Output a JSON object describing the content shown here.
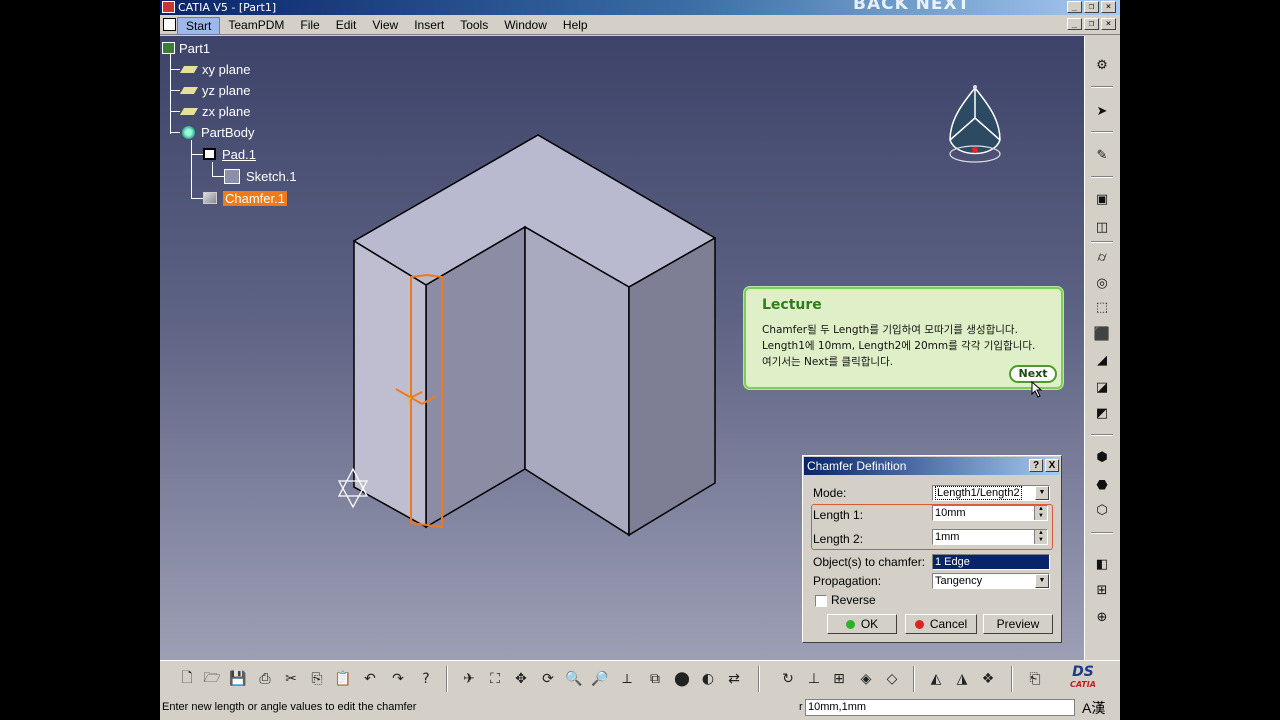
{
  "window": {
    "title": "CATIA V5 - [Part1]",
    "overlay_brand": "BACK  NEXT",
    "controls": [
      "_",
      "❐",
      "×"
    ]
  },
  "menu": {
    "items": [
      "Start",
      "TeamPDM",
      "File",
      "Edit",
      "View",
      "Insert",
      "Tools",
      "Window",
      "Help"
    ]
  },
  "tree": {
    "root": "Part1",
    "planes": [
      "xy plane",
      "yz plane",
      "zx plane"
    ],
    "body": "PartBody",
    "pad": "Pad.1",
    "sketch": "Sketch.1",
    "chamfer": "Chamfer.1"
  },
  "lecture": {
    "title": "Lecture",
    "body": "Chamfer될 두 Length를 기입하여 모따기를 생성합니다.\nLength1에 10mm, Length2에 20mm를 각각 기입합니다.\n여기서는 Next를 클릭합니다.",
    "next_label": "Next"
  },
  "dialog": {
    "title": "Chamfer Definition",
    "help_btn": "?",
    "close_btn": "X",
    "mode_label": "Mode:",
    "mode_value": "Length1/Length2",
    "length1_label": "Length 1:",
    "length1_value": "10mm",
    "length2_label": "Length 2:",
    "length2_value": "1mm",
    "objects_label": "Object(s) to chamfer:",
    "objects_value": "1 Edge",
    "propagation_label": "Propagation:",
    "propagation_value": "Tangency",
    "reverse_label": "Reverse",
    "reverse_checked": false,
    "ok_label": "OK",
    "cancel_label": "Cancel",
    "preview_label": "Preview"
  },
  "status": {
    "message": "Enter new length or angle values to edit the chamfer",
    "prefix": "r",
    "input_value": "10mm,1mm",
    "ime": "A漢"
  },
  "colors": {
    "viewport_top": "#3d4369",
    "viewport_bottom": "#9d9fb5",
    "selection": "#f07a1a",
    "lecture_border": "#7acf56",
    "dialog_title": "#0a246a"
  },
  "logo": {
    "text": "CATIA"
  },
  "toolbar": {
    "standard_icons": [
      "new-icon",
      "open-icon",
      "save-icon",
      "print-icon",
      "cut-icon",
      "copy-icon",
      "paste-icon",
      "undo-icon",
      "redo-icon",
      "whats-this-icon"
    ],
    "view_icons": [
      "fly-icon",
      "fit-all-icon",
      "pan-icon",
      "rotate-icon",
      "zoom-in-icon",
      "zoom-out-icon",
      "normal-view-icon",
      "multi-view-icon",
      "view-mode-icon",
      "hide-show-icon",
      "swap-space-icon"
    ],
    "tool_icons": [
      "update-icon",
      "axis-icon",
      "measure-icon",
      "apply-material-icon",
      "cut-section-icon",
      "render-icon",
      "analysis-icon",
      "catalog-icon",
      "knowledge-icon"
    ]
  }
}
